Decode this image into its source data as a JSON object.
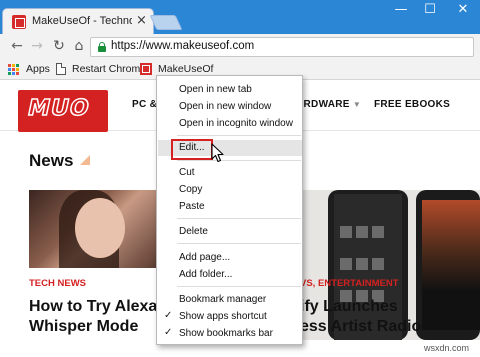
{
  "browser": {
    "tab_title": "MakeUseOf - Technolog",
    "tab_close": "×",
    "window_minimize": "—",
    "window_maximize": "☐",
    "window_close": "✕",
    "url": "https://www.makeuseof.com",
    "nav_back": "←",
    "nav_forward": "→",
    "nav_reload": "↻",
    "nav_home": "⌂"
  },
  "bookmarks": {
    "apps": "Apps",
    "restart": "Restart Chrome",
    "muo": "MakeUseOf"
  },
  "site": {
    "logo": "MUO",
    "nav_pc": "PC & ",
    "nav_hardware": "ARDWARE",
    "nav_free": "FREE EBOOKS",
    "section_title": "News",
    "left_category": "TECH NEWS",
    "left_headline_1": "How to Try Alexa's",
    "left_headline_2": "Whisper Mode",
    "right_category": "VS, ENTERTAINMENT",
    "right_headline_1": "ify Launches",
    "right_headline_2": "ess Artist Radio"
  },
  "context_menu": {
    "items": [
      "Open in new tab",
      "Open in new window",
      "Open in incognito window",
      "Edit...",
      "Cut",
      "Copy",
      "Paste",
      "Delete",
      "Add page...",
      "Add folder...",
      "Bookmark manager",
      "Show apps shortcut",
      "Show bookmarks bar"
    ],
    "checkmark": "✓"
  },
  "watermark": "wsxdn.com",
  "colors": {
    "brand_red": "#d42121",
    "titlebar_blue": "#2b86d6",
    "secure_green": "#1a8f3a"
  }
}
